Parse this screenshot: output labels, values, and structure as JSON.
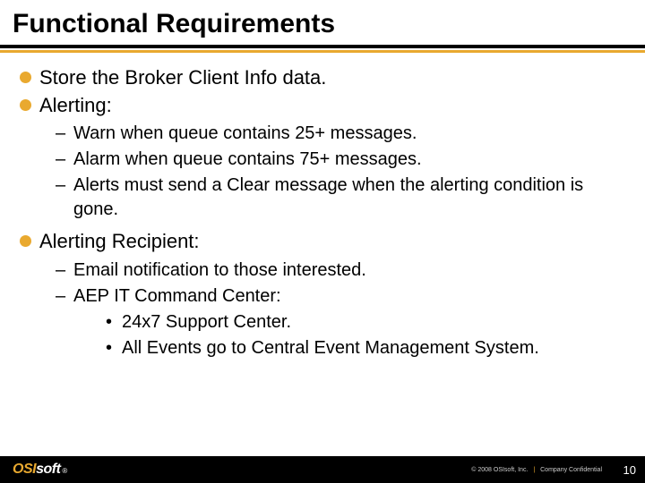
{
  "title": "Functional Requirements",
  "bullets": {
    "b1": "Store the Broker Client Info data.",
    "b2": "Alerting:",
    "b2_sub": {
      "s1": "Warn when queue contains 25+ messages.",
      "s2": "Alarm when queue contains 75+ messages.",
      "s3": "Alerts must send a Clear message when the alerting condition is gone."
    },
    "b3": "Alerting Recipient:",
    "b3_sub": {
      "s1": "Email notification to those interested.",
      "s2": "AEP IT Command Center:",
      "s2_sub": {
        "ss1": "24x7 Support Center.",
        "ss2": "All Events go to Central Event Management System."
      }
    }
  },
  "footer": {
    "logo_osi": "OSI",
    "logo_soft": "soft",
    "logo_reg": "®",
    "copyright_left": "© 2008 OSIsoft, Inc.",
    "copyright_right": "Company Confidential",
    "pagenum": "10"
  }
}
